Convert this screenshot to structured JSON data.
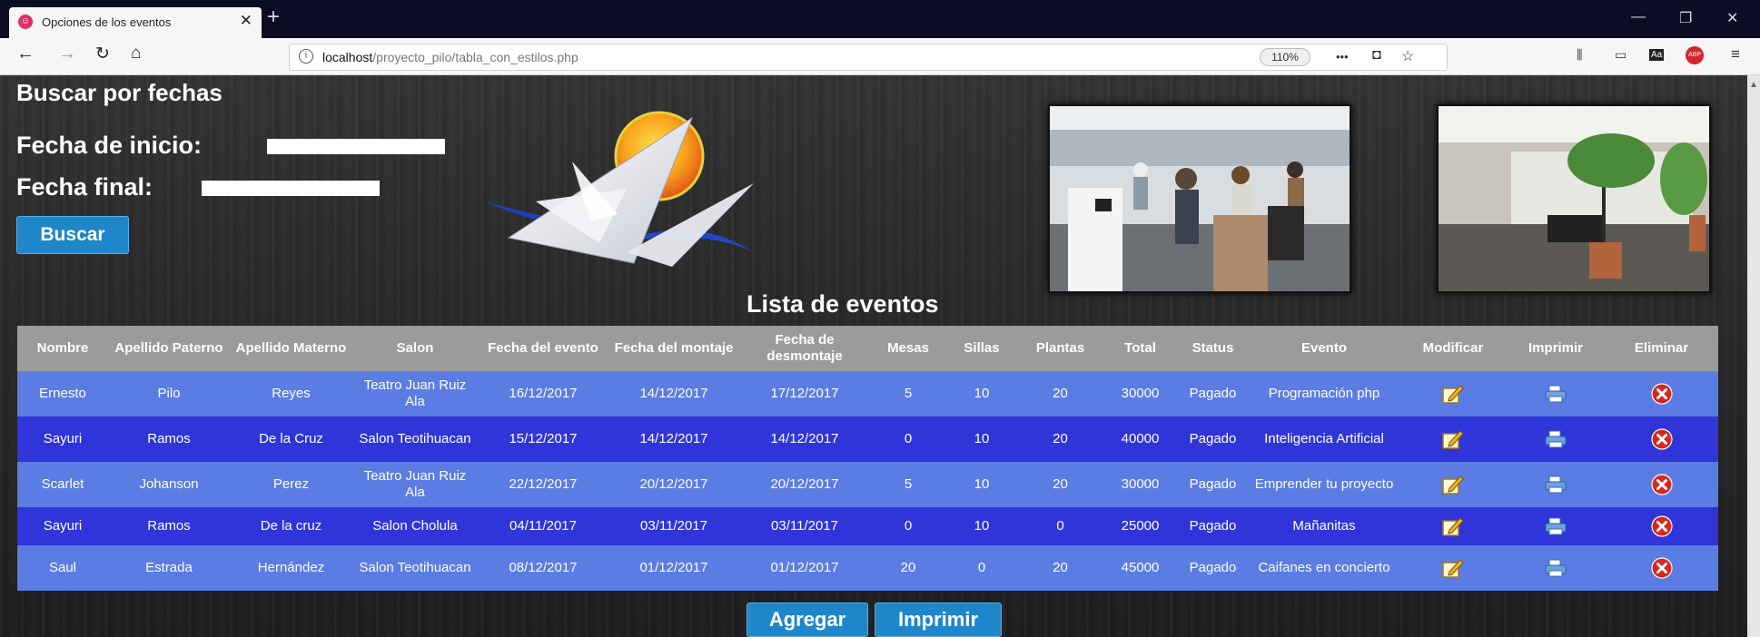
{
  "browser": {
    "tab_title": "Opciones de los eventos",
    "tab_close": "✕",
    "new_tab": "+",
    "url_host": "localhost",
    "url_path": "/proyecto_pilo/tabla_con_estilos.php",
    "zoom": "110%",
    "more": "•••"
  },
  "search": {
    "heading": "Buscar por fechas",
    "start_label": "Fecha de inicio:",
    "start_value": "",
    "end_label": "Fecha final:",
    "end_value": "",
    "button": "Buscar"
  },
  "list_heading": "Lista de eventos",
  "table": {
    "headers": {
      "nombre": "Nombre",
      "apellido_paterno": "Apellido Paterno",
      "apellido_materno": "Apellido Materno",
      "salon": "Salon",
      "fecha_evento": "Fecha del evento",
      "fecha_montaje": "Fecha del montaje",
      "fecha_desmontaje": "Fecha de desmontaje",
      "mesas": "Mesas",
      "sillas": "Sillas",
      "plantas": "Plantas",
      "total": "Total",
      "status": "Status",
      "evento": "Evento",
      "modificar": "Modificar",
      "imprimir": "Imprimir",
      "eliminar": "Eliminar"
    },
    "rows": [
      {
        "nombre": "Ernesto",
        "apellido_paterno": "Pilo",
        "apellido_materno": "Reyes",
        "salon": "Teatro Juan Ruiz Ala",
        "fecha_evento": "16/12/2017",
        "fecha_montaje": "14/12/2017",
        "fecha_desmontaje": "17/12/2017",
        "mesas": "5",
        "sillas": "10",
        "plantas": "20",
        "total": "30000",
        "status": "Pagado",
        "evento": "Programación php"
      },
      {
        "nombre": "Sayuri",
        "apellido_paterno": "Ramos",
        "apellido_materno": "De la Cruz",
        "salon": "Salon Teotihuacan",
        "fecha_evento": "15/12/2017",
        "fecha_montaje": "14/12/2017",
        "fecha_desmontaje": "14/12/2017",
        "mesas": "0",
        "sillas": "10",
        "plantas": "20",
        "total": "40000",
        "status": "Pagado",
        "evento": "Inteligencia Artificial"
      },
      {
        "nombre": "Scarlet",
        "apellido_paterno": "Johanson",
        "apellido_materno": "Perez",
        "salon": "Teatro Juan Ruiz Ala",
        "fecha_evento": "22/12/2017",
        "fecha_montaje": "20/12/2017",
        "fecha_desmontaje": "20/12/2017",
        "mesas": "5",
        "sillas": "10",
        "plantas": "20",
        "total": "30000",
        "status": "Pagado",
        "evento": "Emprender tu proyecto"
      },
      {
        "nombre": "Sayuri",
        "apellido_paterno": "Ramos",
        "apellido_materno": "De la cruz",
        "salon": "Salon Cholula",
        "fecha_evento": "04/11/2017",
        "fecha_montaje": "03/11/2017",
        "fecha_desmontaje": "03/11/2017",
        "mesas": "0",
        "sillas": "10",
        "plantas": "0",
        "total": "25000",
        "status": "Pagado",
        "evento": "Mañanitas"
      },
      {
        "nombre": "Saul",
        "apellido_paterno": "Estrada",
        "apellido_materno": "Hernández",
        "salon": "Salon Teotihuacan",
        "fecha_evento": "08/12/2017",
        "fecha_montaje": "01/12/2017",
        "fecha_desmontaje": "01/12/2017",
        "mesas": "20",
        "sillas": "0",
        "plantas": "20",
        "total": "45000",
        "status": "Pagado",
        "evento": "Caifanes en concierto"
      }
    ]
  },
  "actions": {
    "agregar": "Agregar",
    "imprimir": "Imprimir"
  },
  "colors": {
    "row_light": "#5b7ce2",
    "row_dark": "#2f35d9",
    "header_bg": "#9b9b9b",
    "button_blue": "#1f86c9"
  }
}
